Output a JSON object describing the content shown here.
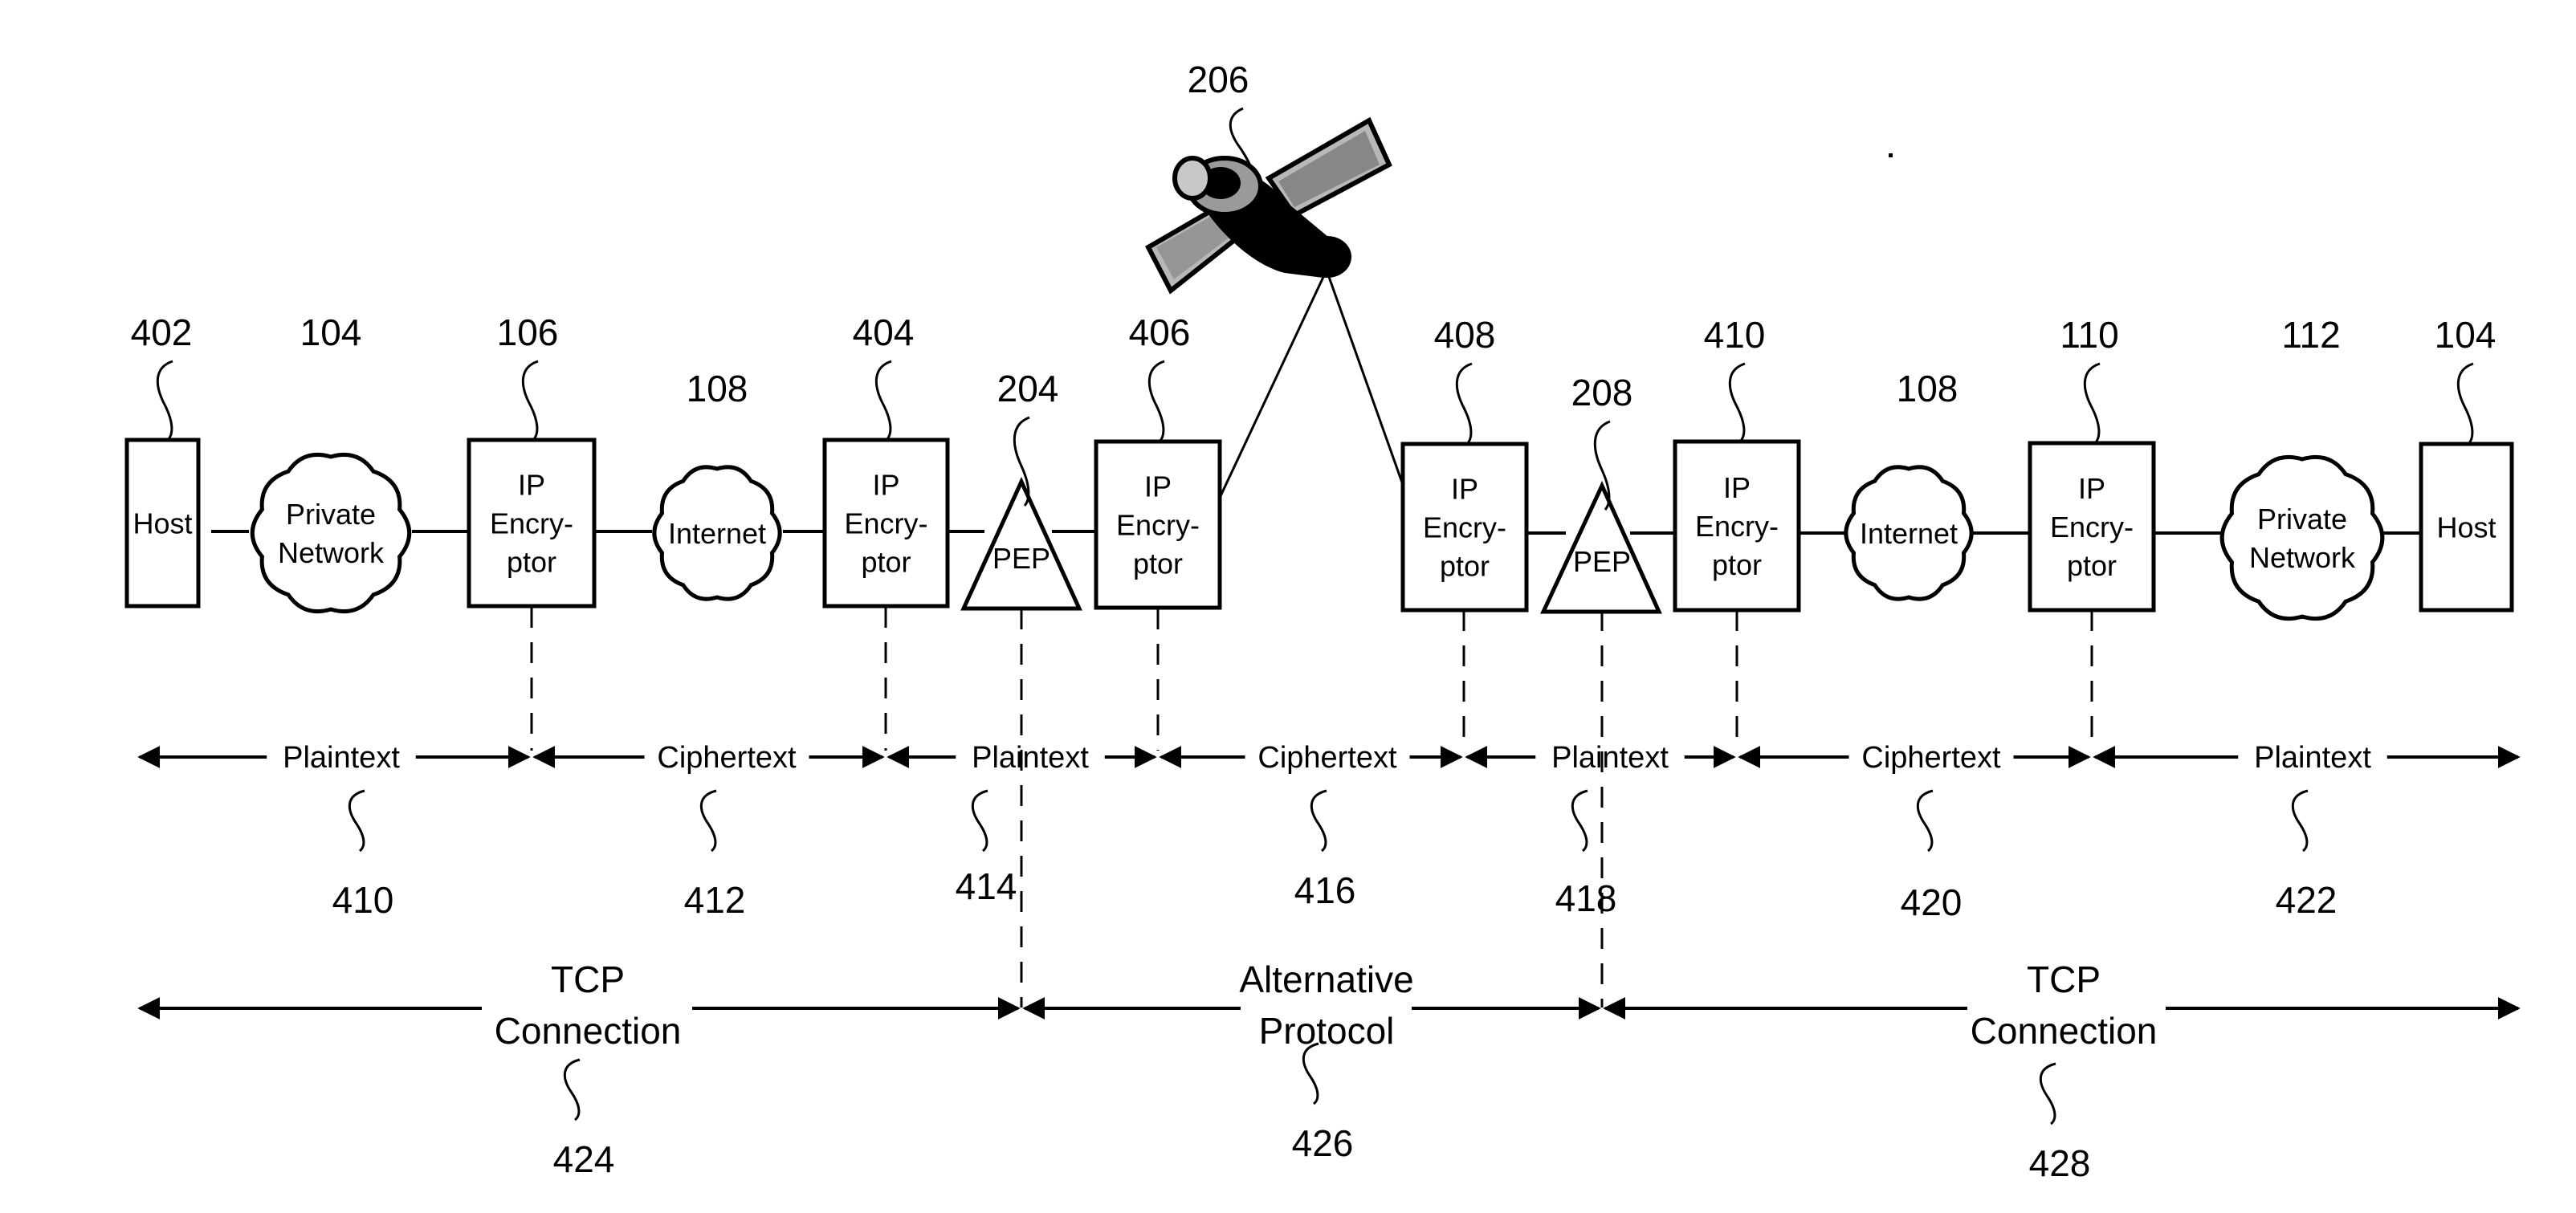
{
  "figure": {
    "satellite": {
      "ref": "206",
      "icon": "satellite-icon"
    },
    "devices": [
      {
        "id": "host-left",
        "type": "box",
        "ref": "402",
        "lines": [
          "Host"
        ]
      },
      {
        "id": "private-network-left",
        "type": "cloud",
        "ref": "104",
        "lines": [
          "Private",
          "Network"
        ]
      },
      {
        "id": "ip-encryptor-106",
        "type": "box",
        "ref": "106",
        "lines": [
          "IP",
          "Encry-",
          "ptor"
        ]
      },
      {
        "id": "internet-left",
        "type": "cloud",
        "ref": "108",
        "lines": [
          "Internet"
        ]
      },
      {
        "id": "ip-encryptor-404",
        "type": "box",
        "ref": "404",
        "lines": [
          "IP",
          "Encry-",
          "ptor"
        ]
      },
      {
        "id": "pep-204",
        "type": "triangle",
        "ref": "204",
        "lines": [
          "PEP"
        ]
      },
      {
        "id": "ip-encryptor-406",
        "type": "box",
        "ref": "406",
        "lines": [
          "IP",
          "Encry-",
          "ptor"
        ]
      },
      {
        "id": "ip-encryptor-408",
        "type": "box",
        "ref": "408",
        "lines": [
          "IP",
          "Encry-",
          "ptor"
        ]
      },
      {
        "id": "pep-208",
        "type": "triangle",
        "ref": "208",
        "lines": [
          "PEP"
        ]
      },
      {
        "id": "ip-encryptor-410",
        "type": "box",
        "ref": "410",
        "lines": [
          "IP",
          "Encry-",
          "ptor"
        ]
      },
      {
        "id": "internet-right",
        "type": "cloud",
        "ref": "108",
        "lines": [
          "Internet"
        ]
      },
      {
        "id": "ip-encryptor-110",
        "type": "box",
        "ref": "110",
        "lines": [
          "IP",
          "Encry-",
          "ptor"
        ]
      },
      {
        "id": "private-network-right",
        "type": "cloud",
        "ref": "112",
        "lines": [
          "Private",
          "Network"
        ]
      },
      {
        "id": "host-right",
        "type": "box",
        "ref": "104",
        "lines": [
          "Host"
        ]
      }
    ],
    "segments": [
      {
        "label": "Plaintext",
        "ref": "410"
      },
      {
        "label": "Ciphertext",
        "ref": "412"
      },
      {
        "label": "Plaintext",
        "ref": "414"
      },
      {
        "label": "Ciphertext",
        "ref": "416"
      },
      {
        "label": "Plaintext",
        "ref": "418"
      },
      {
        "label": "Ciphertext",
        "ref": "420"
      },
      {
        "label": "Plaintext",
        "ref": "422"
      }
    ],
    "connections": [
      {
        "lines": [
          "TCP",
          "Connection"
        ],
        "ref": "424"
      },
      {
        "lines": [
          "Alternative",
          "Protocol"
        ],
        "ref": "426"
      },
      {
        "lines": [
          "TCP",
          "Connection"
        ],
        "ref": "428"
      }
    ]
  }
}
